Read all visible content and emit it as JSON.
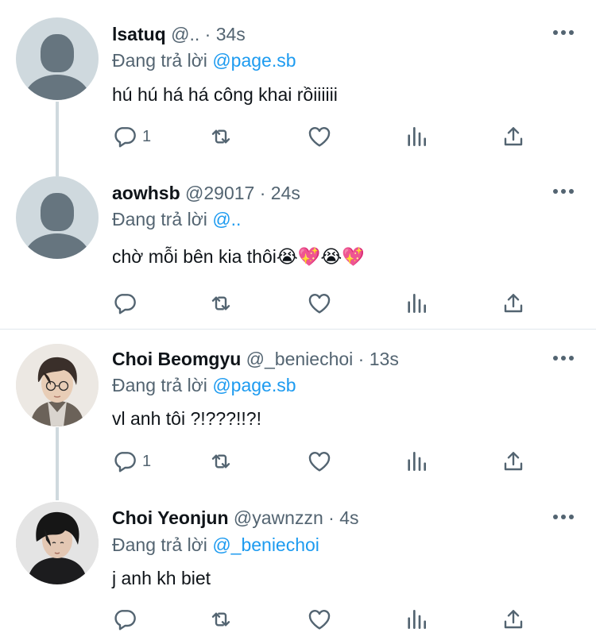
{
  "tweets": [
    {
      "name": "lsatuq",
      "handle": "@..",
      "time": "34s",
      "reply_prefix": "Đang trả lời",
      "reply_to": "@page.sb",
      "text": "hú hú há há công khai rồiiiiii",
      "reply_count": "1",
      "avatar": "default-avatar"
    },
    {
      "name": "aowhsb",
      "handle": "@29017",
      "time": "24s",
      "reply_prefix": "Đang trả lời",
      "reply_to": "@..",
      "text": "chờ mỗi bên kia thôi😭💖😭💖",
      "reply_count": "",
      "avatar": "default-avatar"
    },
    {
      "name": "Choi Beomgyu",
      "handle": "@_beniechoi",
      "time": "13s",
      "reply_prefix": "Đang trả lời",
      "reply_to": "@page.sb",
      "text": "vl anh tôi ?!???!!?!",
      "reply_count": "1",
      "avatar": "photo-avatar"
    },
    {
      "name": "Choi Yeonjun",
      "handle": "@yawnzzn",
      "time": "4s",
      "reply_prefix": "Đang trả lời",
      "reply_to": "@_beniechoi",
      "text": "j anh kh biet",
      "reply_count": "",
      "avatar": "photo-avatar"
    }
  ],
  "icons": {
    "reply": "reply-icon",
    "retweet": "retweet-icon",
    "like": "heart-icon",
    "views": "views-icon",
    "share": "share-icon",
    "more": "more-icon"
  },
  "colors": {
    "text": "#0f1419",
    "secondary": "#536471",
    "link": "#1d9bf0",
    "thread_line": "#cfd9de",
    "divider": "#e1e8ed"
  }
}
